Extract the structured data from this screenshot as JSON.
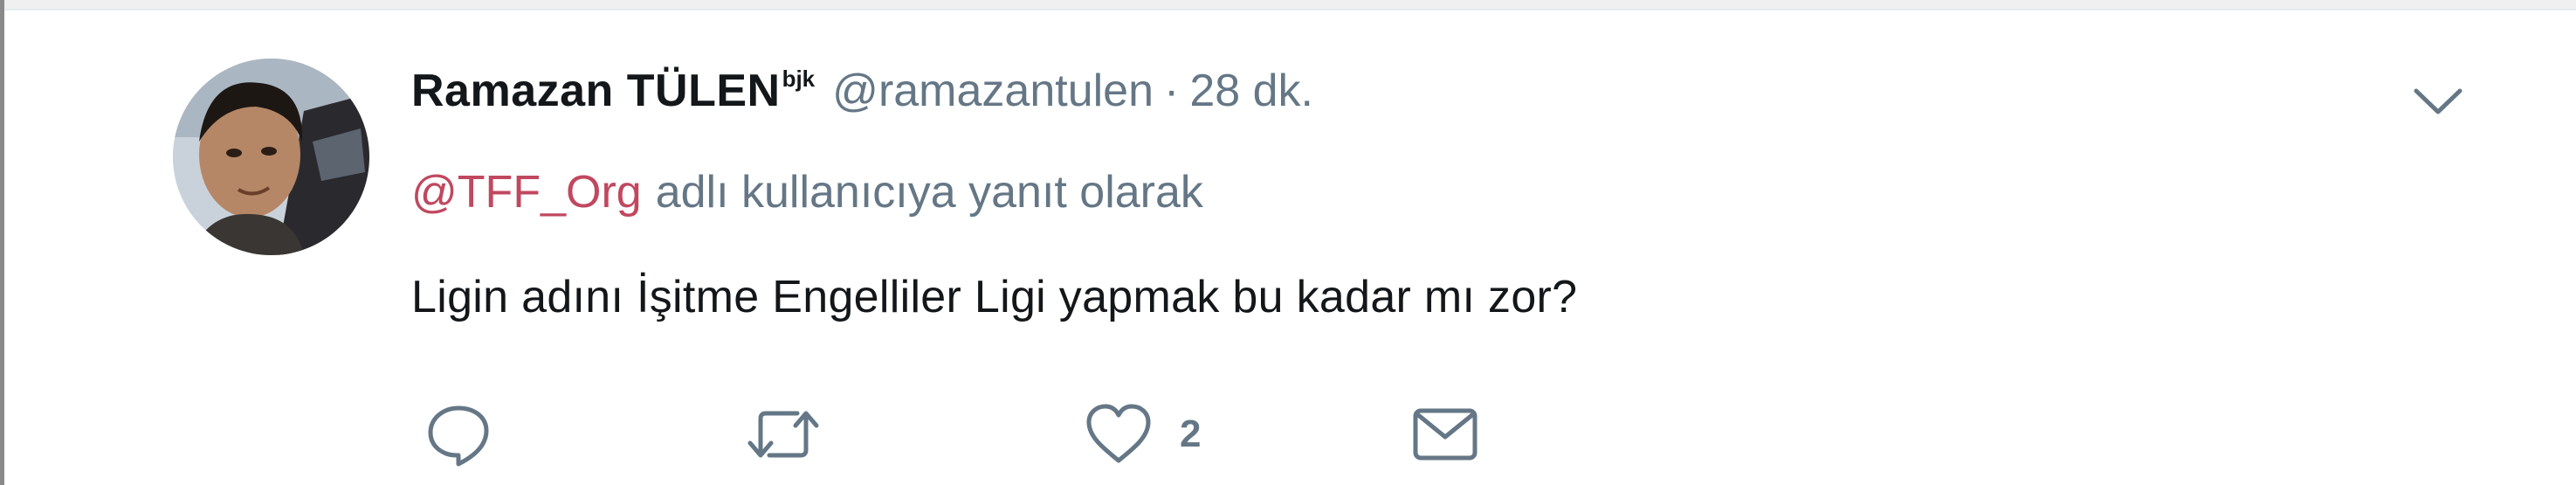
{
  "tweet": {
    "author": {
      "display_name": "Ramazan TÜLEN",
      "name_suffix": "bjk",
      "handle": "@ramazantulen",
      "avatar_icon": "user-avatar-photo"
    },
    "separator": "·",
    "time_ago": "28 dk.",
    "reply_to": {
      "mention": "@TFF_Org",
      "text": "adlı kullanıcıya yanıt olarak"
    },
    "text": "Ligin adını İşitme Engelliler Ligi yapmak bu kadar mı zor?",
    "actions": {
      "reply_icon": "reply-icon",
      "retweet_icon": "retweet-icon",
      "like_icon": "heart-icon",
      "like_count": "2",
      "message_icon": "envelope-icon"
    },
    "menu_icon": "chevron-down-icon"
  },
  "colors": {
    "text_primary": "#14171a",
    "text_secondary": "#657786",
    "mention": "#c0485f",
    "icon": "#657786"
  }
}
